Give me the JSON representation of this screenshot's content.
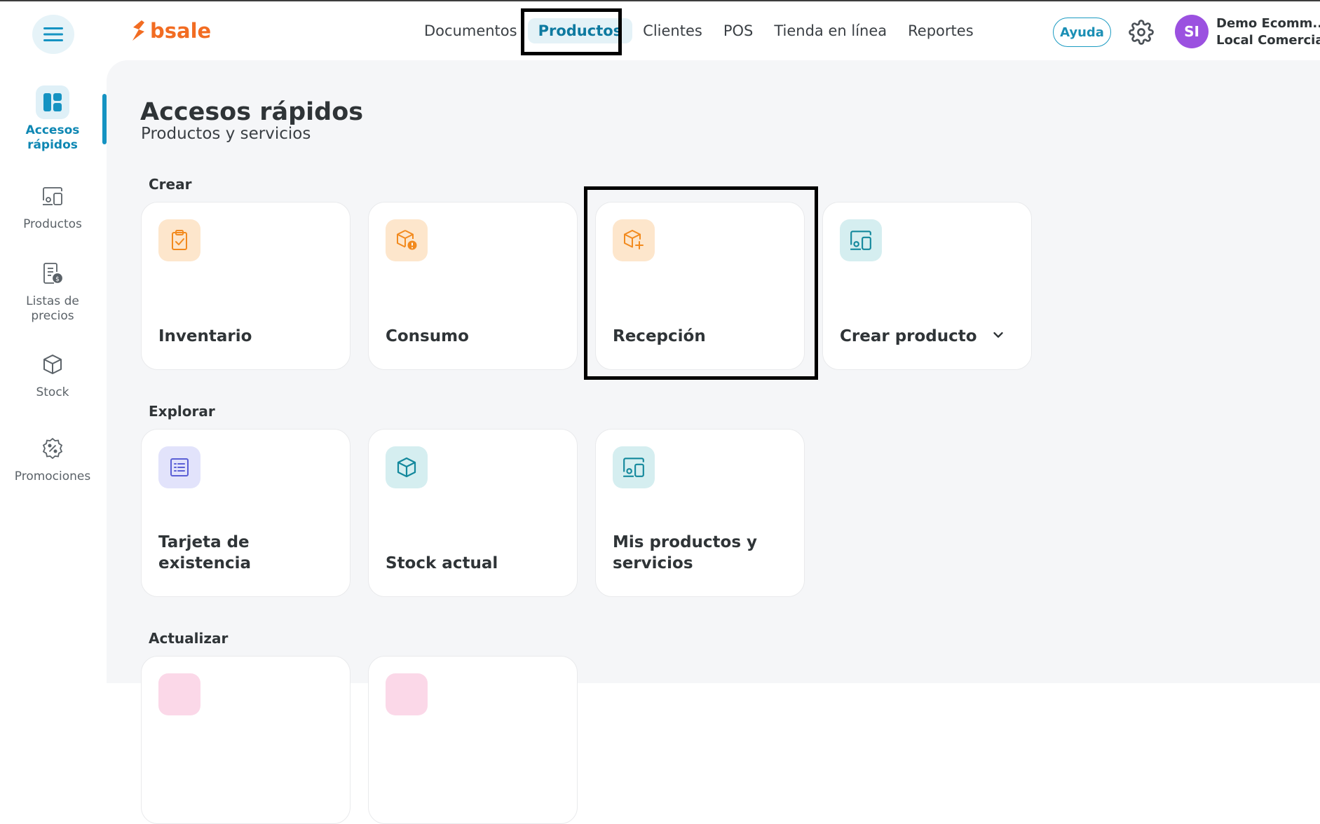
{
  "app": {
    "logo_text": "bsale",
    "brand_color": "#f26c22",
    "accent_color": "#1593c2"
  },
  "header": {
    "nav": [
      {
        "label": "Documentos",
        "active": false
      },
      {
        "label": "Productos",
        "active": true
      },
      {
        "label": "Clientes",
        "active": false
      },
      {
        "label": "POS",
        "active": false
      },
      {
        "label": "Tienda en línea",
        "active": false
      },
      {
        "label": "Reportes",
        "active": false
      }
    ],
    "help_label": "Ayuda",
    "avatar_initials": "SI",
    "user_name": "Demo Ecomm...",
    "user_company": "Local Comercial"
  },
  "sidebar": {
    "items": [
      {
        "label": "Accesos rápidos",
        "icon": "dashboard-icon",
        "active": true
      },
      {
        "label": "Productos",
        "icon": "devices-icon",
        "active": false
      },
      {
        "label": "Listas de precios",
        "icon": "price-list-icon",
        "active": false
      },
      {
        "label": "Stock",
        "icon": "box-icon",
        "active": false
      },
      {
        "label": "Promociones",
        "icon": "discount-badge-icon",
        "active": false
      }
    ]
  },
  "main": {
    "title": "Accesos rápidos",
    "subtitle": "Productos y servicios",
    "sections": [
      {
        "title": "Crear",
        "cards": [
          {
            "label": "Inventario",
            "icon": "clipboard-check-icon",
            "color": "orange"
          },
          {
            "label": "Consumo",
            "icon": "box-alert-icon",
            "color": "orange"
          },
          {
            "label": "Recepción",
            "icon": "box-add-icon",
            "color": "orange"
          },
          {
            "label": "Crear producto",
            "icon": "devices-icon",
            "color": "teal",
            "has_dropdown": true
          }
        ]
      },
      {
        "title": "Explorar",
        "cards": [
          {
            "label": "Tarjeta de existencia",
            "icon": "list-card-icon",
            "color": "purple"
          },
          {
            "label": "Stock actual",
            "icon": "box-icon",
            "color": "teal"
          },
          {
            "label": "Mis productos y servicios",
            "icon": "devices-icon",
            "color": "teal"
          }
        ]
      },
      {
        "title": "Actualizar",
        "cards": [
          {
            "label": "",
            "icon": "unknown-icon",
            "color": "pink"
          },
          {
            "label": "",
            "icon": "unknown-icon",
            "color": "pink"
          }
        ]
      }
    ]
  }
}
